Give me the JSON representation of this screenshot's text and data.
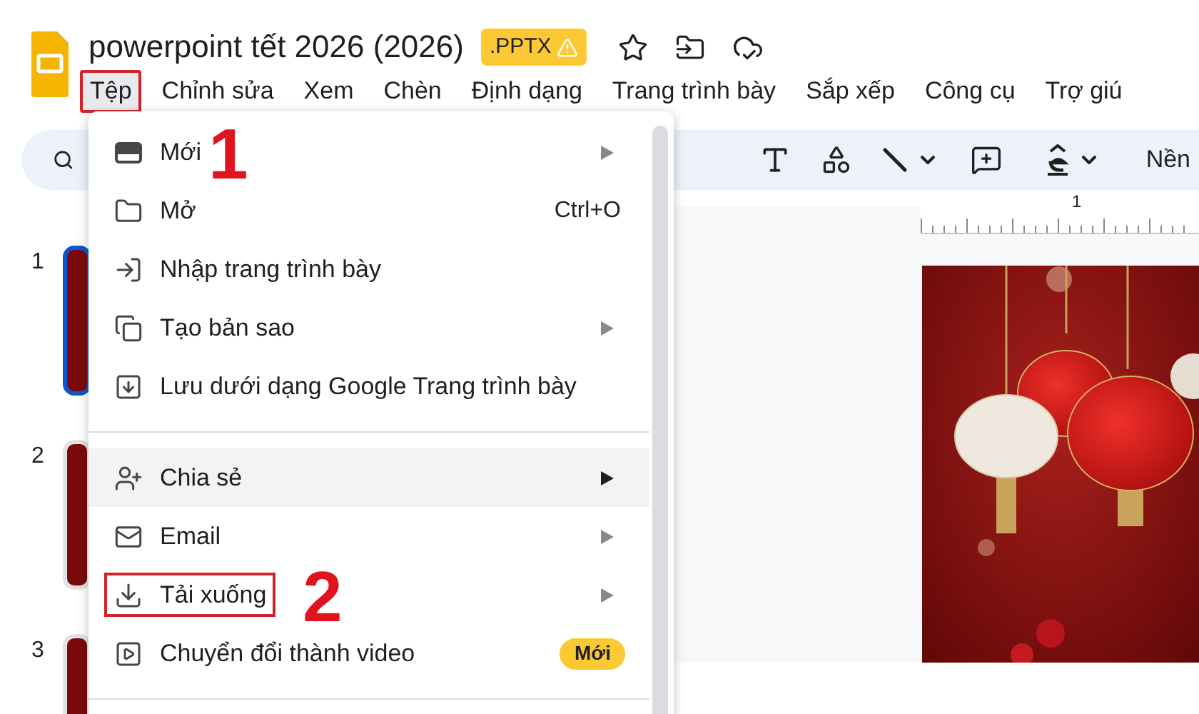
{
  "document": {
    "title": "powerpoint tết 2026 (2026)",
    "badge": ".PPTX"
  },
  "menu_bar": [
    {
      "label": "Tệp",
      "selected": true,
      "annotated": true
    },
    {
      "label": "Chỉnh sửa",
      "selected": false,
      "annotated": false
    },
    {
      "label": "Xem",
      "selected": false,
      "annotated": false
    },
    {
      "label": "Chèn",
      "selected": false,
      "annotated": false
    },
    {
      "label": "Định dạng",
      "selected": false,
      "annotated": false
    },
    {
      "label": "Trang trình bày",
      "selected": false,
      "annotated": false
    },
    {
      "label": "Sắp xếp",
      "selected": false,
      "annotated": false
    },
    {
      "label": "Công cụ",
      "selected": false,
      "annotated": false
    },
    {
      "label": "Trợ giú",
      "selected": false,
      "annotated": false
    }
  ],
  "toolbar": {
    "background_button": "Nền"
  },
  "ruler": {
    "mark": "1"
  },
  "slides": [
    {
      "number": "1",
      "selected": true
    },
    {
      "number": "2",
      "selected": false
    },
    {
      "number": "3",
      "selected": false
    }
  ],
  "file_menu": [
    {
      "kind": "item",
      "label": "Mới",
      "submenu": true,
      "highlighted": false,
      "annotated": false
    },
    {
      "kind": "item",
      "label": "Mở",
      "shortcut": "Ctrl+O",
      "submenu": false,
      "highlighted": false,
      "annotated": false
    },
    {
      "kind": "item",
      "label": "Nhập trang trình bày",
      "submenu": false,
      "highlighted": false,
      "annotated": false
    },
    {
      "kind": "item",
      "label": "Tạo bản sao",
      "submenu": true,
      "highlighted": false,
      "annotated": false
    },
    {
      "kind": "item",
      "label": "Lưu dưới dạng Google Trang trình bày",
      "submenu": false,
      "highlighted": false,
      "annotated": false
    },
    {
      "kind": "divider"
    },
    {
      "kind": "item",
      "label": "Chia sẻ",
      "submenu": true,
      "highlighted": true,
      "annotated": false
    },
    {
      "kind": "item",
      "label": "Email",
      "submenu": true,
      "highlighted": false,
      "annotated": false
    },
    {
      "kind": "item",
      "label": "Tải xuống",
      "submenu": true,
      "highlighted": false,
      "annotated": true
    },
    {
      "kind": "item",
      "label": "Chuyển đổi thành video",
      "badge": "Mới",
      "submenu": false,
      "highlighted": false,
      "annotated": false
    },
    {
      "kind": "divider"
    }
  ],
  "annotations": [
    {
      "label": "1"
    },
    {
      "label": "2"
    }
  ]
}
